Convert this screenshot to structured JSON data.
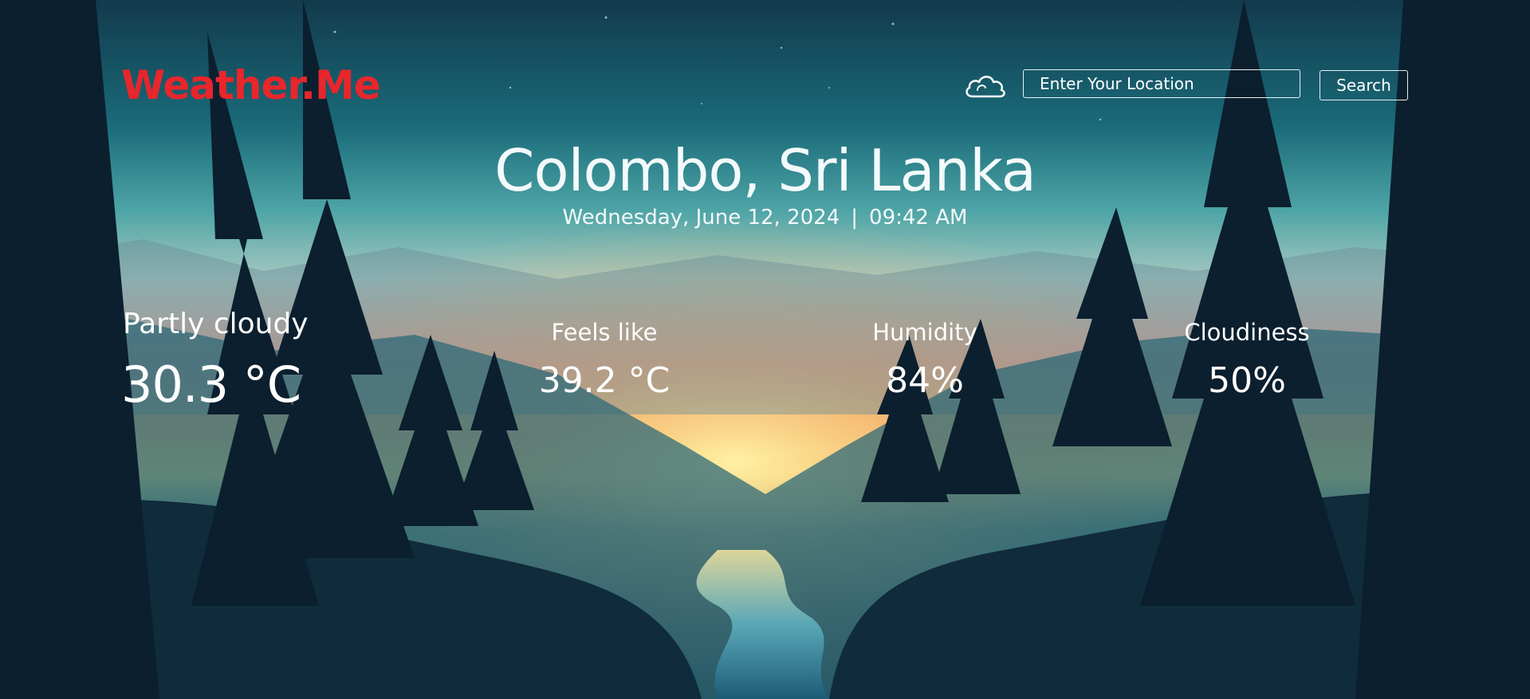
{
  "app": {
    "logo": "Weather.Me"
  },
  "search": {
    "placeholder": "Enter Your Location",
    "value": "",
    "button_label": "Search",
    "icon": "cloud-icon"
  },
  "location": {
    "name": "Colombo, Sri Lanka",
    "date": "Wednesday, June 12, 2024",
    "separator": "|",
    "time": "09:42 AM"
  },
  "current": {
    "condition": "Partly cloudy",
    "temperature": "30.3 °C"
  },
  "stats": {
    "feels_like": {
      "label": "Feels like",
      "value": "39.2 °C"
    },
    "humidity": {
      "label": "Humidity",
      "value": "84%"
    },
    "cloudiness": {
      "label": "Cloudiness",
      "value": "50%"
    }
  },
  "colors": {
    "logo": "#e8262c",
    "text": "#ffffff",
    "border": "#e6f2f4"
  }
}
